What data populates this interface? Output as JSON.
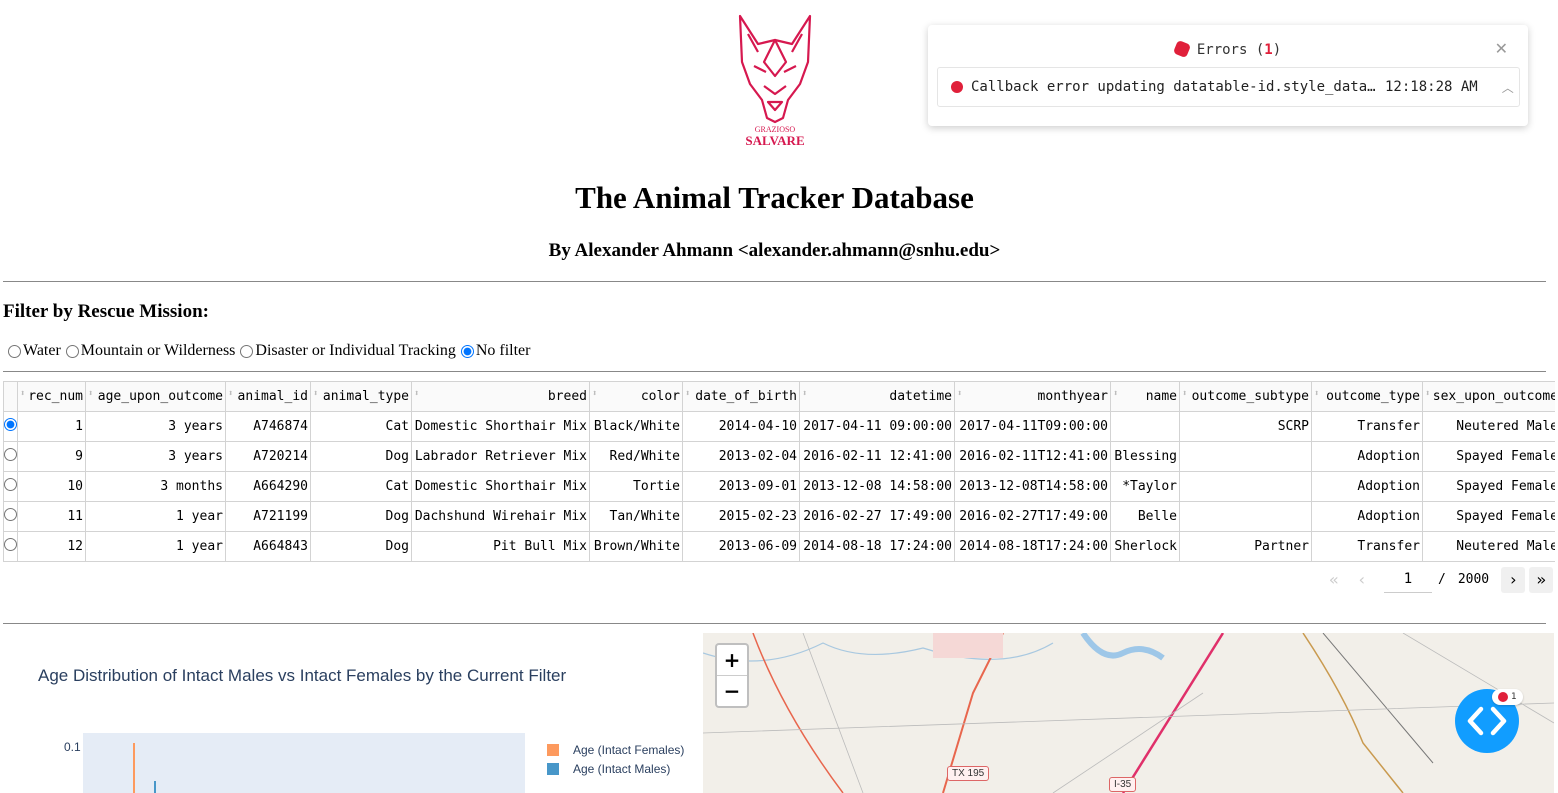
{
  "header": {
    "logo_text_top": "GRAZIOSO",
    "logo_text_bottom": "SALVARE",
    "title": "The Animal Tracker Database",
    "subtitle": "By Alexander Ahmann <alexander.ahmann@snhu.edu>"
  },
  "filter": {
    "heading": "Filter by Rescue Mission:",
    "options": [
      "Water",
      "Mountain or Wilderness",
      "Disaster or Individual Tracking",
      "No filter"
    ],
    "selected": "No filter"
  },
  "table": {
    "columns": [
      "rec_num",
      "age_upon_outcome",
      "animal_id",
      "animal_type",
      "breed",
      "color",
      "date_of_birth",
      "datetime",
      "monthyear",
      "name",
      "outcome_subtype",
      "outcome_type",
      "sex_upon_outcome"
    ],
    "rows": [
      [
        "1",
        "3 years",
        "A746874",
        "Cat",
        "Domestic Shorthair Mix",
        "Black/White",
        "2014-04-10",
        "2017-04-11 09:00:00",
        "2017-04-11T09:00:00",
        "",
        "SCRP",
        "Transfer",
        "Neutered Male"
      ],
      [
        "9",
        "3 years",
        "A720214",
        "Dog",
        "Labrador Retriever Mix",
        "Red/White",
        "2013-02-04",
        "2016-02-11 12:41:00",
        "2016-02-11T12:41:00",
        "Blessing",
        "",
        "Adoption",
        "Spayed Female"
      ],
      [
        "10",
        "3 months",
        "A664290",
        "Cat",
        "Domestic Shorthair Mix",
        "Tortie",
        "2013-09-01",
        "2013-12-08 14:58:00",
        "2013-12-08T14:58:00",
        "*Taylor",
        "",
        "Adoption",
        "Spayed Female"
      ],
      [
        "11",
        "1 year",
        "A721199",
        "Dog",
        "Dachshund Wirehair Mix",
        "Tan/White",
        "2015-02-23",
        "2016-02-27 17:49:00",
        "2016-02-27T17:49:00",
        "Belle",
        "",
        "Adoption",
        "Spayed Female"
      ],
      [
        "12",
        "1 year",
        "A664843",
        "Dog",
        "Pit Bull Mix",
        "Brown/White",
        "2013-06-09",
        "2014-08-18 17:24:00",
        "2014-08-18T17:24:00",
        "Sherlock",
        "Partner",
        "Transfer",
        "Neutered Male"
      ]
    ],
    "selected_row": 0
  },
  "pagination": {
    "current": "1",
    "separator": "/",
    "total": "2000"
  },
  "chart": {
    "title": "Age Distribution of Intact Males  vs Intact Females by the Current Filter",
    "ytick": "0.1",
    "legend": [
      {
        "label": "Age (Intact Females)",
        "color": "#fd9a5e"
      },
      {
        "label": "Age (Intact Males)",
        "color": "#4897c9"
      }
    ]
  },
  "map": {
    "zoom_in": "+",
    "zoom_out": "−",
    "road_labels": [
      "TX 195",
      "I-35"
    ]
  },
  "errors": {
    "label": "Errors",
    "count": "1",
    "message": "Callback error updating datatable-id.style_data…",
    "time": "12:18:28 AM"
  },
  "debug": {
    "badge_count": "1"
  }
}
